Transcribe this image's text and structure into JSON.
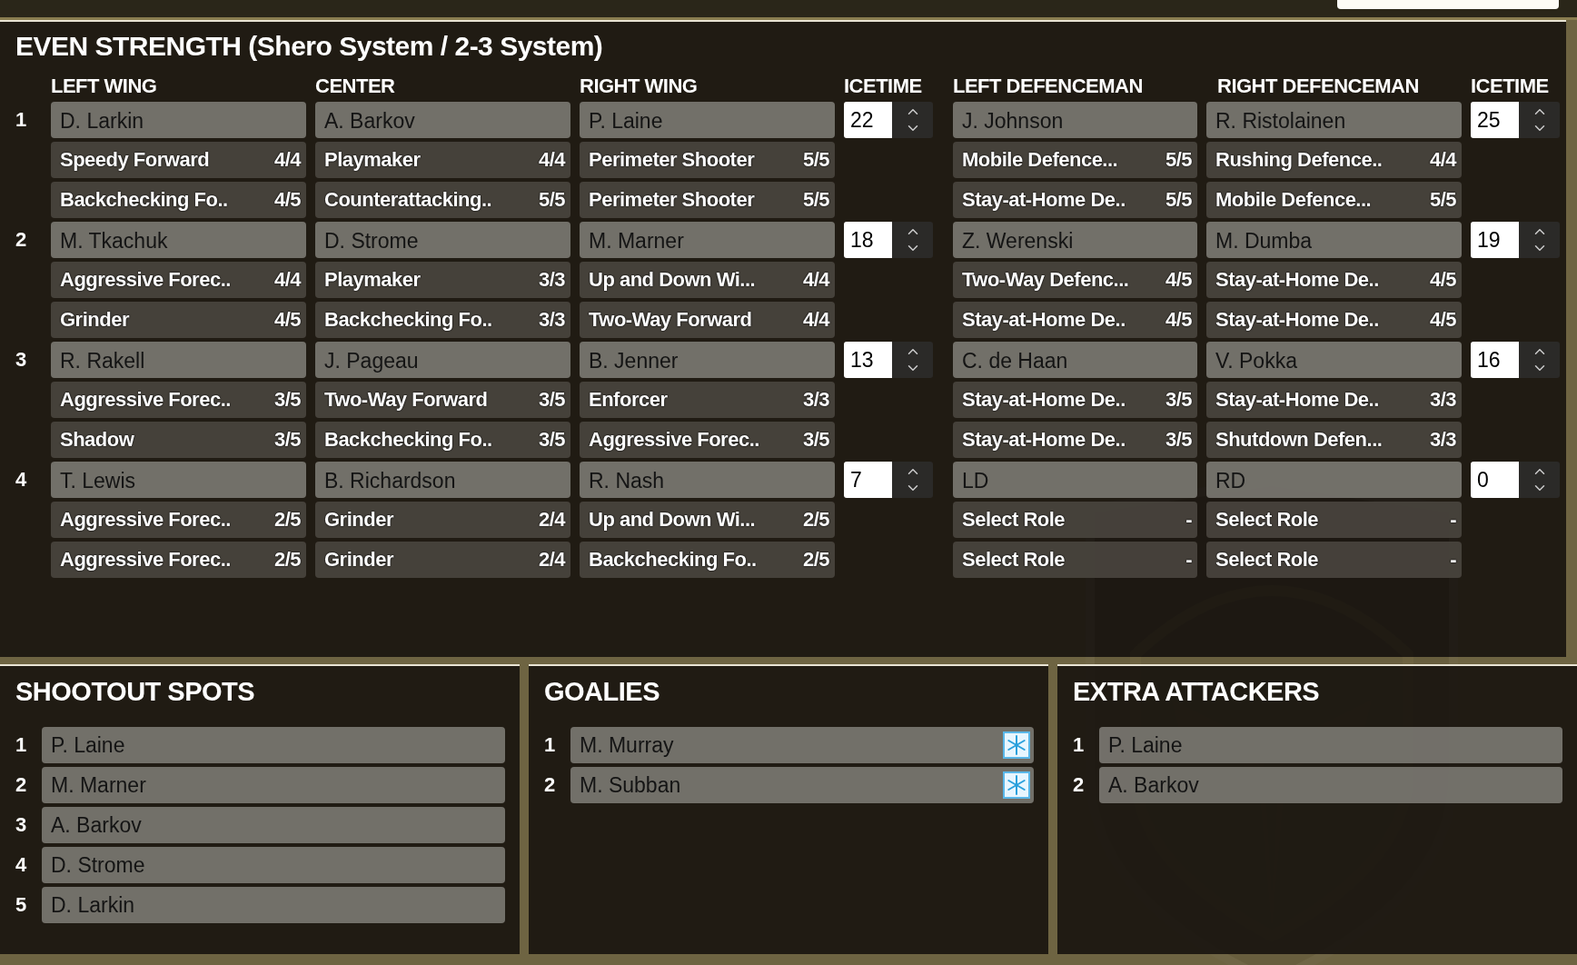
{
  "title": "EVEN STRENGTH (Shero System / 2-3 System)",
  "columns": [
    "LEFT WING",
    "CENTER",
    "RIGHT WING",
    "ICETIME",
    "LEFT DEFENCEMAN",
    "RIGHT DEFENCEMAN",
    "ICETIME"
  ],
  "lines": [
    {
      "number": "1",
      "forwards": [
        {
          "name": "D. Larkin",
          "roles": [
            {
              "role": "Speedy Forward",
              "rating": "4/4"
            },
            {
              "role": "Backchecking Fo..",
              "rating": "4/5"
            }
          ]
        },
        {
          "name": "A. Barkov",
          "roles": [
            {
              "role": "Playmaker",
              "rating": "4/4"
            },
            {
              "role": "Counterattacking..",
              "rating": "5/5"
            }
          ]
        },
        {
          "name": "P. Laine",
          "roles": [
            {
              "role": "Perimeter Shooter",
              "rating": "5/5"
            },
            {
              "role": "Perimeter Shooter",
              "rating": "5/5"
            }
          ]
        }
      ],
      "forward_icetime": "22",
      "defense": [
        {
          "name": "J. Johnson",
          "roles": [
            {
              "role": "Mobile Defence...",
              "rating": "5/5"
            },
            {
              "role": "Stay-at-Home De..",
              "rating": "5/5"
            }
          ]
        },
        {
          "name": "R. Ristolainen",
          "roles": [
            {
              "role": "Rushing Defence..",
              "rating": "4/4"
            },
            {
              "role": "Mobile Defence...",
              "rating": "5/5"
            }
          ]
        }
      ],
      "defense_icetime": "25"
    },
    {
      "number": "2",
      "forwards": [
        {
          "name": "M. Tkachuk",
          "roles": [
            {
              "role": "Aggressive Forec..",
              "rating": "4/4"
            },
            {
              "role": "Grinder",
              "rating": "4/5"
            }
          ]
        },
        {
          "name": "D. Strome",
          "roles": [
            {
              "role": "Playmaker",
              "rating": "3/3"
            },
            {
              "role": "Backchecking Fo..",
              "rating": "3/3"
            }
          ]
        },
        {
          "name": "M. Marner",
          "roles": [
            {
              "role": "Up and Down Wi...",
              "rating": "4/4"
            },
            {
              "role": "Two-Way Forward",
              "rating": "4/4"
            }
          ]
        }
      ],
      "forward_icetime": "18",
      "defense": [
        {
          "name": "Z. Werenski",
          "roles": [
            {
              "role": "Two-Way Defenc...",
              "rating": "4/5"
            },
            {
              "role": "Stay-at-Home De..",
              "rating": "4/5"
            }
          ]
        },
        {
          "name": "M. Dumba",
          "roles": [
            {
              "role": "Stay-at-Home De..",
              "rating": "4/5"
            },
            {
              "role": "Stay-at-Home De..",
              "rating": "4/5"
            }
          ]
        }
      ],
      "defense_icetime": "19"
    },
    {
      "number": "3",
      "forwards": [
        {
          "name": "R. Rakell",
          "roles": [
            {
              "role": "Aggressive Forec..",
              "rating": "3/5"
            },
            {
              "role": "Shadow",
              "rating": "3/5"
            }
          ]
        },
        {
          "name": "J. Pageau",
          "roles": [
            {
              "role": "Two-Way Forward",
              "rating": "3/5"
            },
            {
              "role": "Backchecking Fo..",
              "rating": "3/5"
            }
          ]
        },
        {
          "name": "B. Jenner",
          "roles": [
            {
              "role": "Enforcer",
              "rating": "3/3"
            },
            {
              "role": "Aggressive Forec..",
              "rating": "3/5"
            }
          ]
        }
      ],
      "forward_icetime": "13",
      "defense": [
        {
          "name": "C. de Haan",
          "roles": [
            {
              "role": "Stay-at-Home De..",
              "rating": "3/5"
            },
            {
              "role": "Stay-at-Home De..",
              "rating": "3/5"
            }
          ]
        },
        {
          "name": "V. Pokka",
          "roles": [
            {
              "role": "Stay-at-Home De..",
              "rating": "3/3"
            },
            {
              "role": "Shutdown Defen...",
              "rating": "3/3"
            }
          ]
        }
      ],
      "defense_icetime": "16"
    },
    {
      "number": "4",
      "forwards": [
        {
          "name": "T. Lewis",
          "roles": [
            {
              "role": "Aggressive Forec..",
              "rating": "2/5"
            },
            {
              "role": "Aggressive Forec..",
              "rating": "2/5"
            }
          ]
        },
        {
          "name": "B. Richardson",
          "roles": [
            {
              "role": "Grinder",
              "rating": "2/4"
            },
            {
              "role": "Grinder",
              "rating": "2/4"
            }
          ]
        },
        {
          "name": "R. Nash",
          "roles": [
            {
              "role": "Up and Down Wi...",
              "rating": "2/5"
            },
            {
              "role": "Backchecking Fo..",
              "rating": "2/5"
            }
          ]
        }
      ],
      "forward_icetime": "7",
      "defense": [
        {
          "name": "LD",
          "roles": [
            {
              "role": "Select Role",
              "rating": "-"
            },
            {
              "role": "Select Role",
              "rating": "-"
            }
          ]
        },
        {
          "name": "RD",
          "roles": [
            {
              "role": "Select Role",
              "rating": "-"
            },
            {
              "role": "Select Role",
              "rating": "-"
            }
          ]
        }
      ],
      "defense_icetime": "0"
    }
  ],
  "panels": [
    {
      "kind": "plain",
      "title": "SHOOTOUT SPOTS",
      "items": [
        {
          "number": "1",
          "name": "P. Laine"
        },
        {
          "number": "2",
          "name": "M. Marner"
        },
        {
          "number": "3",
          "name": "A. Barkov"
        },
        {
          "number": "4",
          "name": "D. Strome"
        },
        {
          "number": "5",
          "name": "D. Larkin"
        }
      ]
    },
    {
      "kind": "goalies",
      "title": "GOALIES",
      "items": [
        {
          "number": "1",
          "name": "M. Murray"
        },
        {
          "number": "2",
          "name": "M. Subban"
        }
      ]
    },
    {
      "kind": "plain",
      "title": "EXTRA ATTACKERS",
      "items": [
        {
          "number": "1",
          "name": "P. Laine"
        },
        {
          "number": "2",
          "name": "A. Barkov"
        }
      ]
    }
  ]
}
